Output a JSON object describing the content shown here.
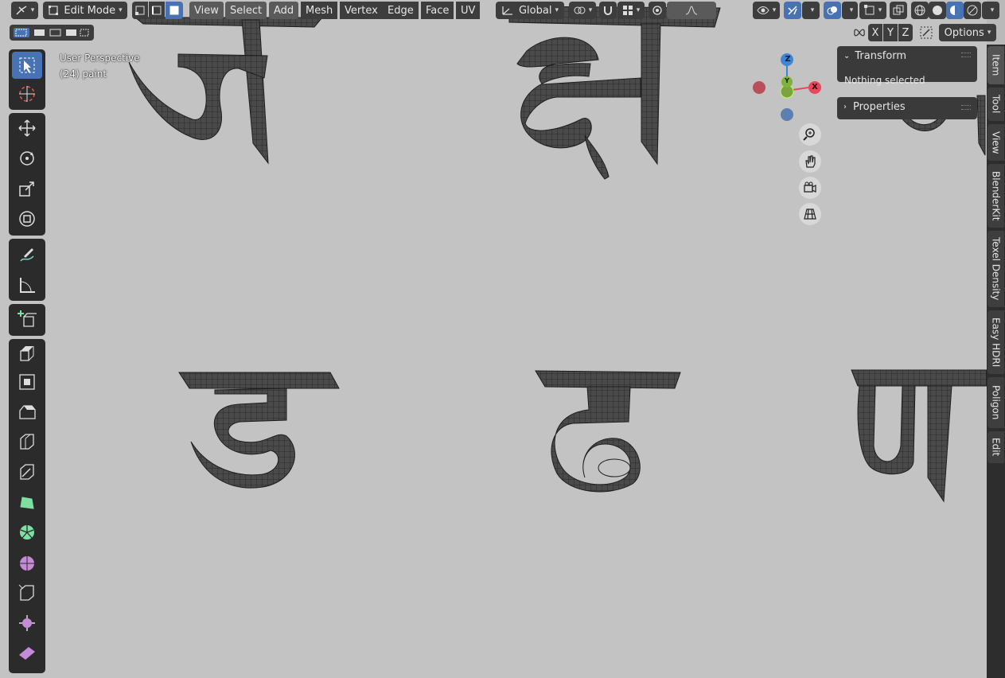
{
  "header": {
    "mode": "Edit Mode",
    "menus": [
      "View",
      "Select",
      "Add",
      "Mesh",
      "Vertex",
      "Edge",
      "Face",
      "UV"
    ],
    "orientation": "Global",
    "options_label": "Options",
    "axis_x": "X",
    "axis_y": "Y",
    "axis_z": "Z"
  },
  "viewport": {
    "title": "User Perspective",
    "object": "(24) paint"
  },
  "gizmo": {
    "z": "Z",
    "y": "Y",
    "x": "X"
  },
  "panel": {
    "transform_label": "Transform",
    "nothing_selected": "Nothing selected",
    "properties_label": "Properties"
  },
  "tabs": [
    "Item",
    "Tool",
    "View",
    "BlenderKit",
    "Texel Density",
    "Easy HDRI",
    "Poligon",
    "Edit"
  ],
  "tools": [
    {
      "name": "select-box-tool",
      "icon": "select-box-icon"
    },
    {
      "name": "cursor-tool",
      "icon": "cursor-icon"
    },
    {
      "name": "move-tool",
      "icon": "move-icon"
    },
    {
      "name": "rotate-tool",
      "icon": "rotate-icon"
    },
    {
      "name": "scale-tool",
      "icon": "scale-icon"
    },
    {
      "name": "transform-tool",
      "icon": "transform-icon"
    },
    {
      "name": "annotate-tool",
      "icon": "annotate-icon"
    },
    {
      "name": "measure-tool",
      "icon": "measure-icon"
    },
    {
      "name": "add-cube-tool",
      "icon": "add-cube-icon"
    },
    {
      "name": "extrude-tool",
      "icon": "extrude-icon"
    },
    {
      "name": "inset-tool",
      "icon": "inset-icon"
    },
    {
      "name": "bevel-tool",
      "icon": "bevel-icon"
    },
    {
      "name": "loop-cut-tool",
      "icon": "loop-cut-icon"
    },
    {
      "name": "knife-tool",
      "icon": "knife-icon"
    },
    {
      "name": "poly-build-tool",
      "icon": "poly-build-icon"
    },
    {
      "name": "spin-tool",
      "icon": "spin-icon"
    },
    {
      "name": "smooth-tool",
      "icon": "smooth-icon"
    },
    {
      "name": "edge-slide-tool",
      "icon": "edge-slide-icon"
    },
    {
      "name": "shrink-fatten-tool",
      "icon": "shrink-fatten-icon"
    },
    {
      "name": "shear-tool",
      "icon": "shear-icon"
    }
  ],
  "colors": {
    "accent": "#4772b3",
    "x_axis": "#e8485a",
    "y_axis": "#7fb23b",
    "z_axis": "#3d86d6",
    "background": "#c3c3c3"
  }
}
